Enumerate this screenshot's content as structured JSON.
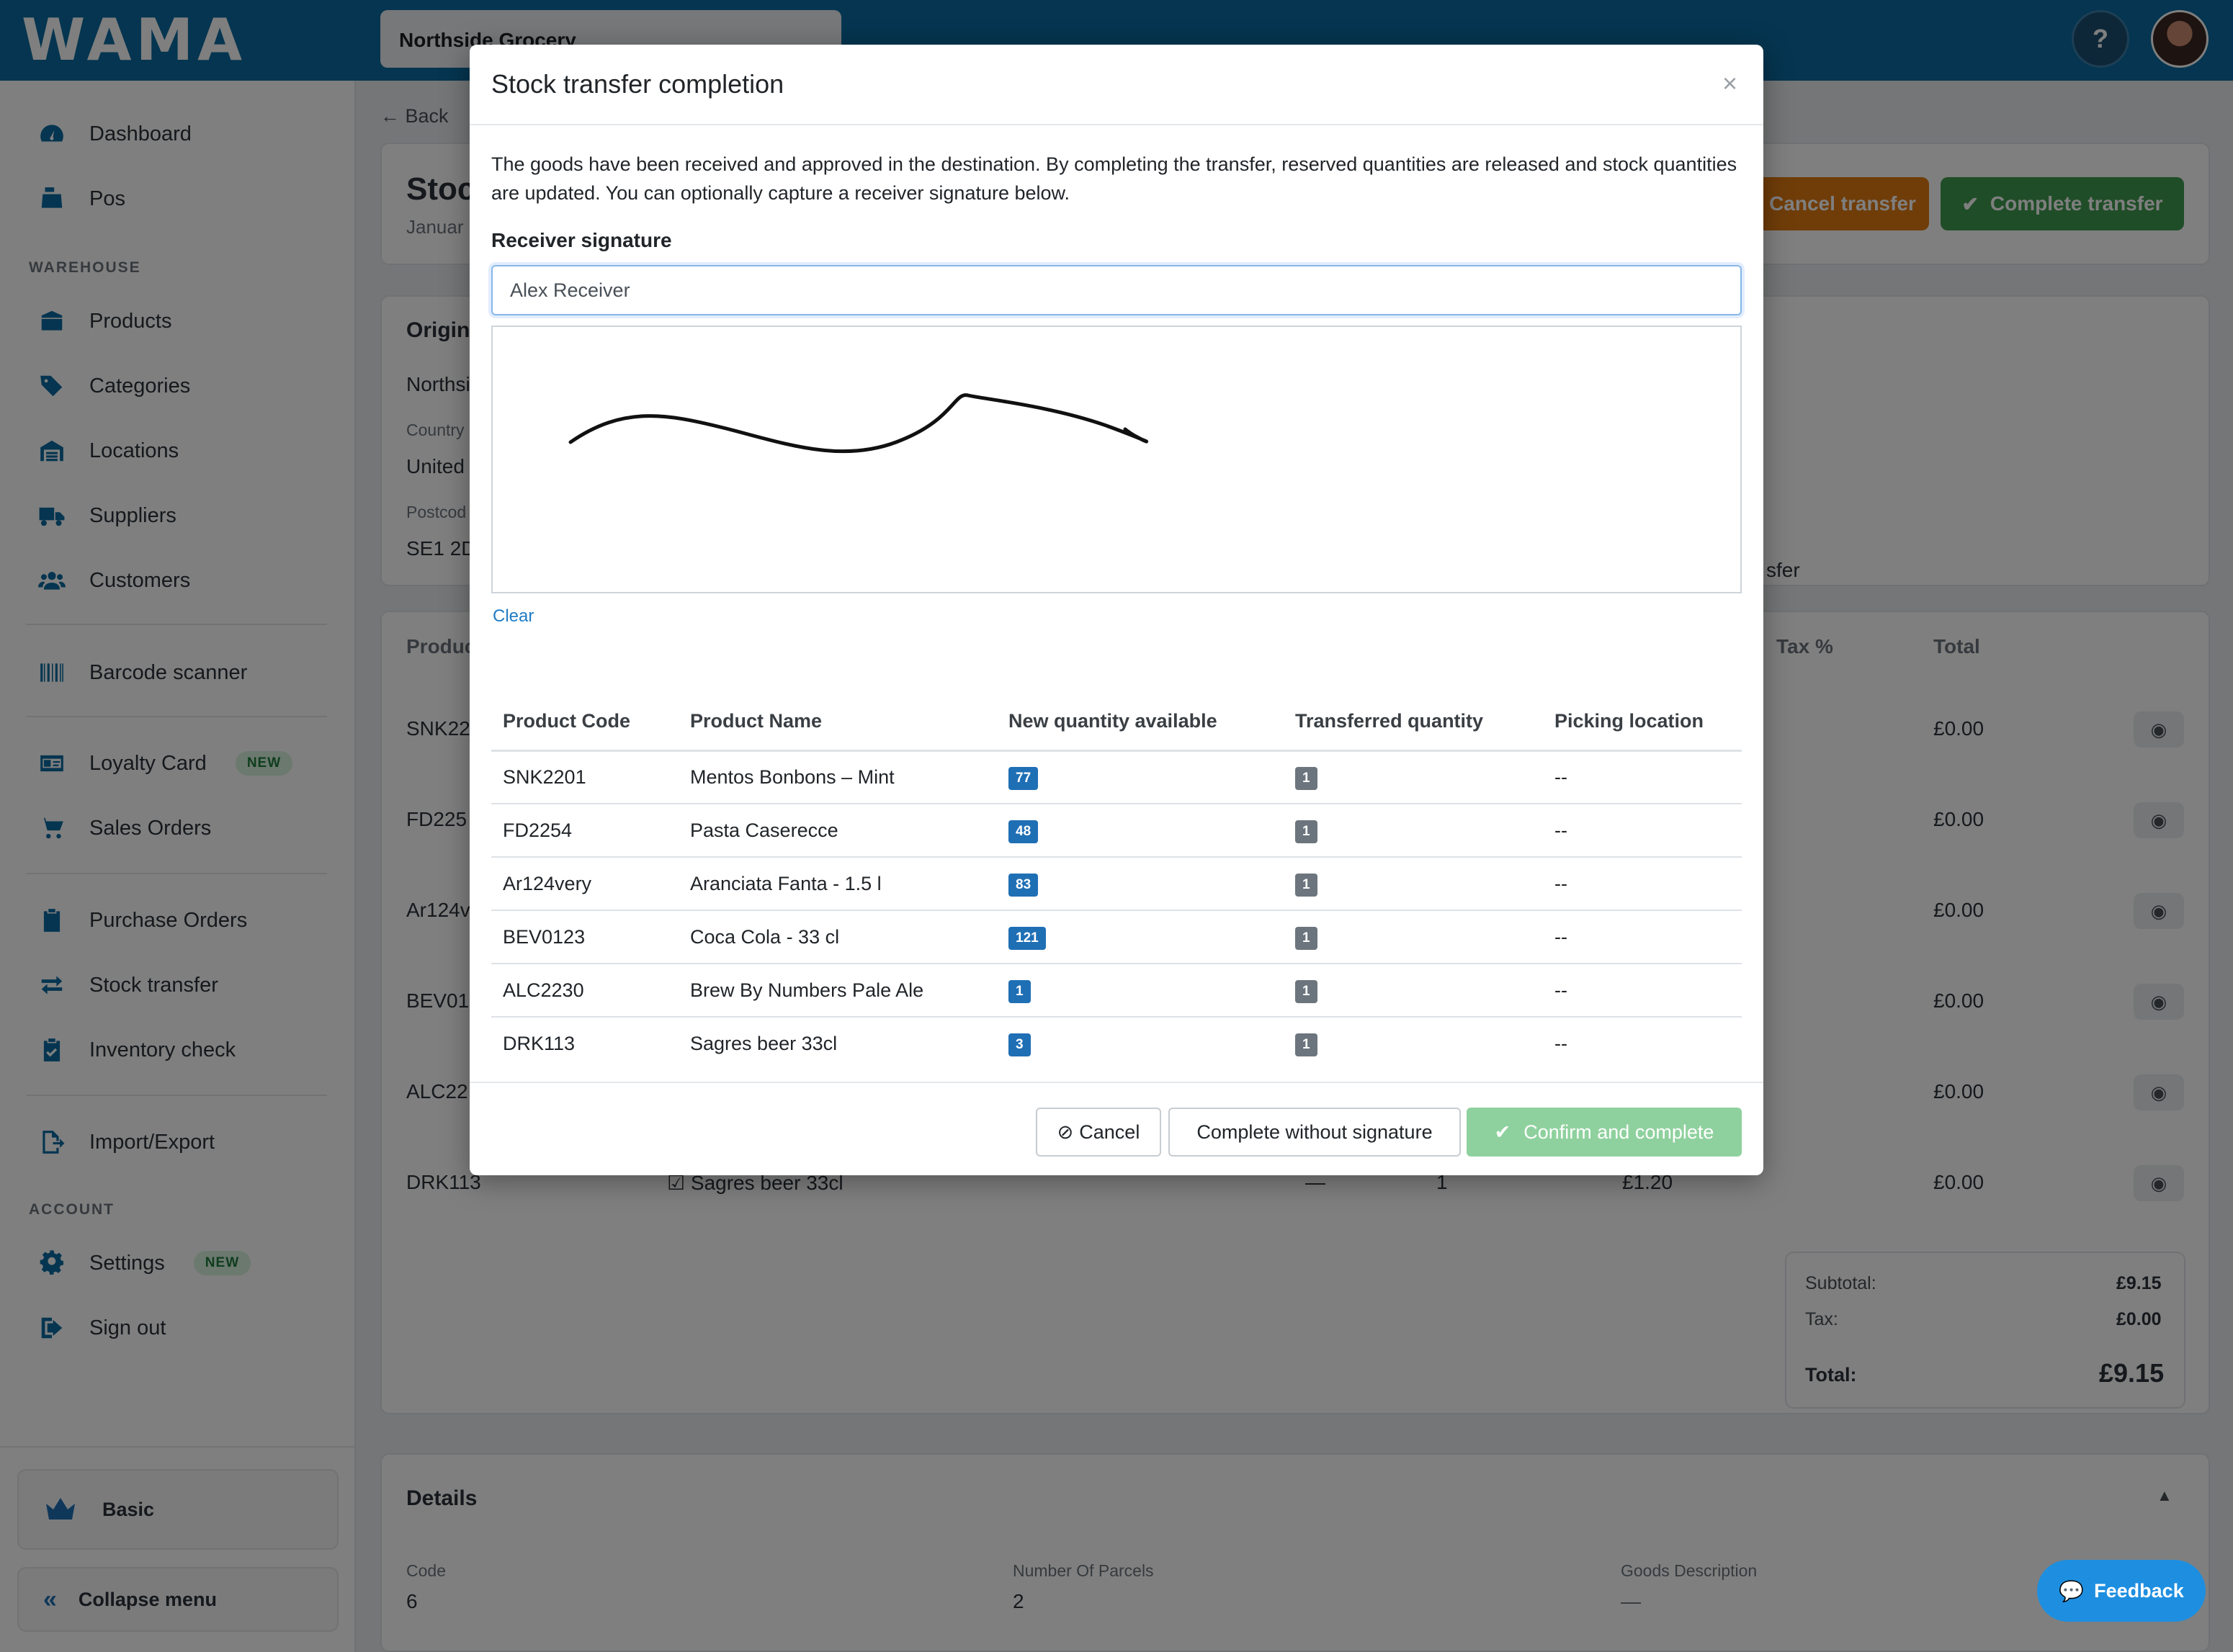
{
  "app": {
    "logo": "WAMA",
    "store": "Northside Grocery"
  },
  "sidebar": {
    "items": [
      {
        "label": "Dashboard",
        "icon": "gauge-icon"
      },
      {
        "label": "Pos",
        "icon": "cash-register-icon"
      },
      {
        "label": "Products",
        "icon": "box-icon"
      },
      {
        "label": "Categories",
        "icon": "tags-icon"
      },
      {
        "label": "Locations",
        "icon": "warehouse-icon"
      },
      {
        "label": "Suppliers",
        "icon": "truck-icon"
      },
      {
        "label": "Customers",
        "icon": "users-icon"
      },
      {
        "label": "Barcode scanner",
        "icon": "barcode-icon"
      },
      {
        "label": "Loyalty Card",
        "icon": "id-card-icon",
        "badge": "NEW"
      },
      {
        "label": "Sales Orders",
        "icon": "cart-icon"
      },
      {
        "label": "Purchase Orders",
        "icon": "clipboard-icon"
      },
      {
        "label": "Stock transfer",
        "icon": "arrows-exchange-icon"
      },
      {
        "label": "Inventory check",
        "icon": "clipboard-check-icon"
      },
      {
        "label": "Import/Export",
        "icon": "file-export-icon"
      },
      {
        "label": "Settings",
        "icon": "gear-icon",
        "badge": "NEW"
      },
      {
        "label": "Sign out",
        "icon": "sign-out-icon"
      }
    ],
    "sections": {
      "warehouse": "WAREHOUSE",
      "account": "ACCOUNT"
    },
    "plan": "Basic",
    "collapse": "Collapse menu"
  },
  "background": {
    "back": "Back",
    "title_partial": "Stoc",
    "date_partial": "Januar",
    "cancel_transfer": "Cancel transfer",
    "complete_transfer": "Complete transfer",
    "origin_heading": "Origin",
    "origin_name": "Northsi",
    "country_label": "Country",
    "country_value": "United",
    "postcode_label": "Postcod",
    "postcode_value": "SE1 2D",
    "transfer_partial": "sfer",
    "product_header": "Produc",
    "tax_header": "Tax %",
    "total_header": "Total",
    "rows": [
      {
        "code": "SNK22",
        "total": "£0.00"
      },
      {
        "code": "FD225",
        "total": "£0.00"
      },
      {
        "code": "Ar124v",
        "total": "£0.00"
      },
      {
        "code": "BEV01",
        "total": "£0.00"
      },
      {
        "code": "ALC22",
        "total": "£0.00"
      },
      {
        "code": "DRK113",
        "total": "£0.00",
        "name": "Sagres beer 33cl",
        "dash": "—",
        "qty": "1",
        "price": "£1.20"
      }
    ],
    "subtotal_label": "Subtotal:",
    "subtotal_value": "£9.15",
    "tax_label": "Tax:",
    "tax_value": "£0.00",
    "total_label": "Total:",
    "total_value": "£9.15",
    "details_heading": "Details",
    "code_label": "Code",
    "code_value": "6",
    "parcels_label": "Number Of Parcels",
    "parcels_value": "2",
    "goods_label": "Goods Description",
    "goods_value": "—",
    "feedback": "Feedback"
  },
  "modal": {
    "title": "Stock transfer completion",
    "close": "×",
    "description": "The goods have been received and approved in the destination. By completing the transfer, reserved quantities are released and stock quantities are updated. You can optionally capture a receiver signature below.",
    "signature_label": "Receiver signature",
    "signature_value": "Alex Receiver",
    "clear": "Clear",
    "columns": [
      "Product Code",
      "Product Name",
      "New quantity available",
      "Transferred quantity",
      "Picking location"
    ],
    "rows": [
      {
        "code": "SNK2201",
        "name": "Mentos Bonbons – Mint",
        "available": "77",
        "transferred": "1",
        "location": "--"
      },
      {
        "code": "FD2254",
        "name": "Pasta Caserecce",
        "available": "48",
        "transferred": "1",
        "location": "--"
      },
      {
        "code": "Ar124very",
        "name": "Aranciata Fanta - 1.5 l",
        "available": "83",
        "transferred": "1",
        "location": "--"
      },
      {
        "code": "BEV0123",
        "name": "Coca Cola - 33 cl",
        "available": "121",
        "transferred": "1",
        "location": "--"
      },
      {
        "code": "ALC2230",
        "name": "Brew By Numbers Pale Ale",
        "available": "1",
        "transferred": "1",
        "location": "--"
      },
      {
        "code": "DRK113",
        "name": "Sagres beer 33cl",
        "available": "3",
        "transferred": "1",
        "location": "--"
      }
    ],
    "buttons": {
      "cancel": "Cancel",
      "no_signature": "Complete without signature",
      "confirm": "Confirm and complete"
    }
  },
  "colors": {
    "brand": "#0b6aa1",
    "success": "#3f9b4f",
    "warning": "#e07b12",
    "confirm_disabled": "#8fd19e"
  }
}
